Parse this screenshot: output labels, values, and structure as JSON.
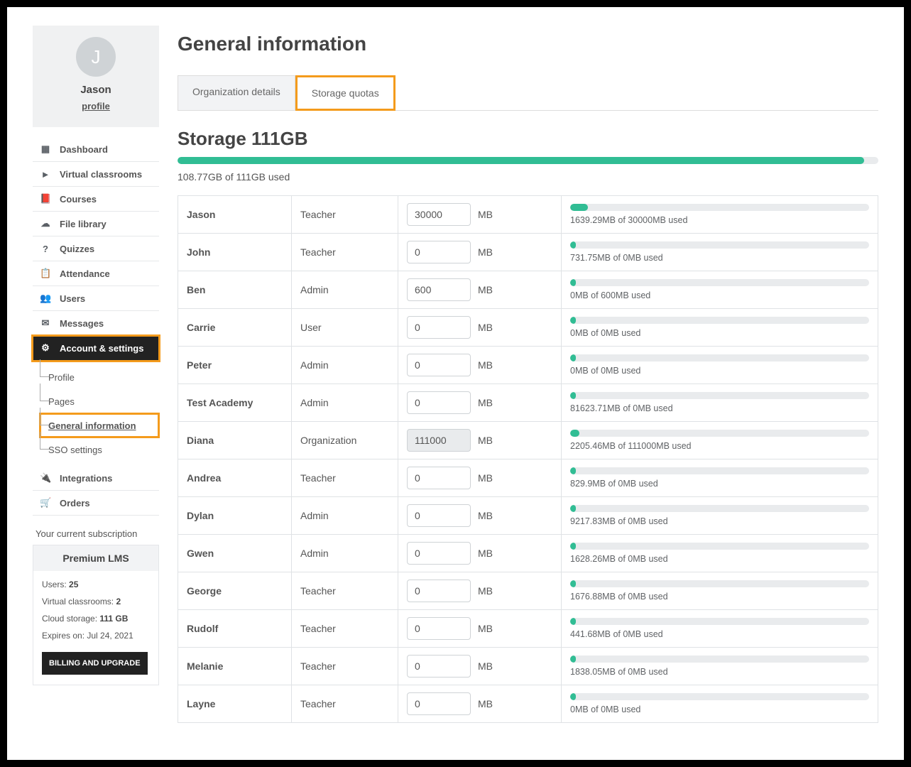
{
  "profile": {
    "initial": "J",
    "name": "Jason",
    "link_label": "profile"
  },
  "sidebar": {
    "items": [
      {
        "label": "Dashboard",
        "icon": "▦"
      },
      {
        "label": "Virtual classrooms",
        "icon": "►"
      },
      {
        "label": "Courses",
        "icon": "📕"
      },
      {
        "label": "File library",
        "icon": "☁"
      },
      {
        "label": "Quizzes",
        "icon": "?"
      },
      {
        "label": "Attendance",
        "icon": "📋"
      },
      {
        "label": "Users",
        "icon": "👥"
      },
      {
        "label": "Messages",
        "icon": "✉"
      },
      {
        "label": "Account & settings",
        "icon": "⚙"
      },
      {
        "label": "Integrations",
        "icon": "🔌"
      },
      {
        "label": "Orders",
        "icon": "🛒"
      }
    ],
    "sub": [
      {
        "label": "Profile"
      },
      {
        "label": "Pages"
      },
      {
        "label": "General information"
      },
      {
        "label": "SSO settings"
      }
    ]
  },
  "subscription": {
    "heading": "Your current subscription",
    "plan": "Premium LMS",
    "users_label": "Users:",
    "users_value": "25",
    "classrooms_label": "Virtual classrooms:",
    "classrooms_value": "2",
    "storage_label": "Cloud storage:",
    "storage_value": "111 GB",
    "expires_label": "Expires on:",
    "expires_value": "Jul 24, 2021",
    "button": "BILLING AND UPGRADE"
  },
  "main": {
    "title": "General information",
    "tabs": {
      "org": "Organization details",
      "quotas": "Storage quotas"
    },
    "storage_title": "Storage 111GB",
    "storage_used_line": "108.77GB of 111GB used",
    "storage_fill_pct": 98,
    "mb_unit": "MB",
    "rows": [
      {
        "name": "Jason",
        "role": "Teacher",
        "quota": "30000",
        "readonly": false,
        "usage": "1639.29MB of 30000MB used",
        "fill": 6
      },
      {
        "name": "John",
        "role": "Teacher",
        "quota": "0",
        "readonly": false,
        "usage": "731.75MB of 0MB used",
        "fill": 2
      },
      {
        "name": "Ben",
        "role": "Admin",
        "quota": "600",
        "readonly": false,
        "usage": "0MB of 600MB used",
        "fill": 2
      },
      {
        "name": "Carrie",
        "role": "User",
        "quota": "0",
        "readonly": false,
        "usage": "0MB of 0MB used",
        "fill": 2
      },
      {
        "name": "Peter",
        "role": "Admin",
        "quota": "0",
        "readonly": false,
        "usage": "0MB of 0MB used",
        "fill": 2
      },
      {
        "name": "Test Academy",
        "role": "Admin",
        "quota": "0",
        "readonly": false,
        "usage": "81623.71MB of 0MB used",
        "fill": 2
      },
      {
        "name": "Diana",
        "role": "Organization",
        "quota": "111000",
        "readonly": true,
        "usage": "2205.46MB of 111000MB used",
        "fill": 3
      },
      {
        "name": "Andrea",
        "role": "Teacher",
        "quota": "0",
        "readonly": false,
        "usage": "829.9MB of 0MB used",
        "fill": 2
      },
      {
        "name": "Dylan",
        "role": "Admin",
        "quota": "0",
        "readonly": false,
        "usage": "9217.83MB of 0MB used",
        "fill": 2
      },
      {
        "name": "Gwen",
        "role": "Admin",
        "quota": "0",
        "readonly": false,
        "usage": "1628.26MB of 0MB used",
        "fill": 2
      },
      {
        "name": "George",
        "role": "Teacher",
        "quota": "0",
        "readonly": false,
        "usage": "1676.88MB of 0MB used",
        "fill": 2
      },
      {
        "name": "Rudolf",
        "role": "Teacher",
        "quota": "0",
        "readonly": false,
        "usage": "441.68MB of 0MB used",
        "fill": 2
      },
      {
        "name": "Melanie",
        "role": "Teacher",
        "quota": "0",
        "readonly": false,
        "usage": "1838.05MB of 0MB used",
        "fill": 2
      },
      {
        "name": "Layne",
        "role": "Teacher",
        "quota": "0",
        "readonly": false,
        "usage": "0MB of 0MB used",
        "fill": 2
      }
    ]
  }
}
